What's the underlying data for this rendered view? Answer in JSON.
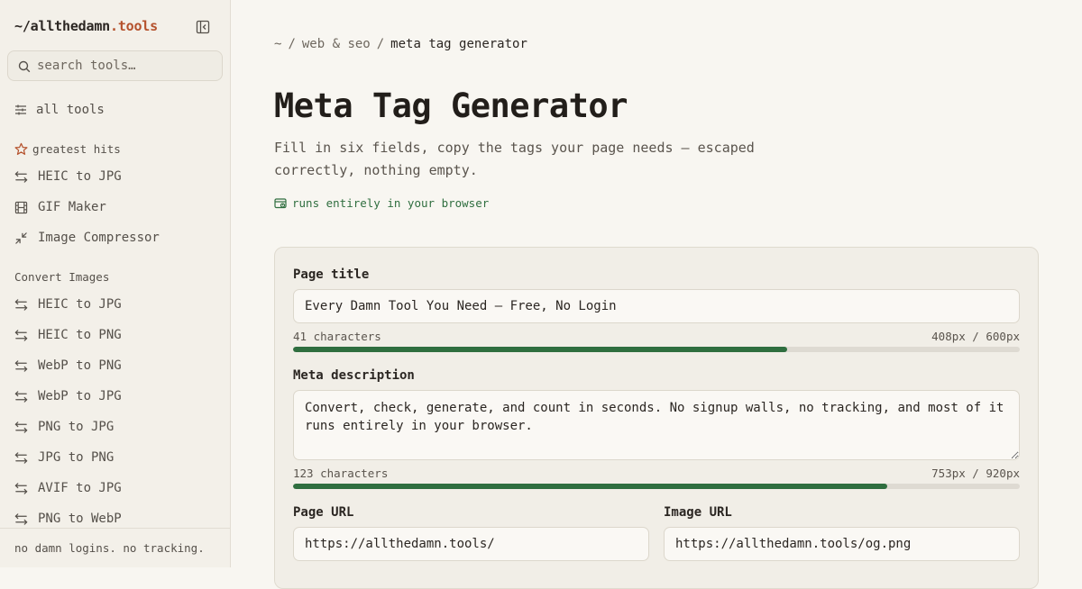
{
  "sidebar": {
    "brand": {
      "prefix": "~/",
      "name": "allthedamn",
      "suffix": ".tools"
    },
    "search": {
      "placeholder": "search tools…"
    },
    "all_tools": "all tools",
    "greatest_hits": {
      "title": "greatest hits",
      "items": [
        {
          "label": "HEIC to JPG",
          "icon": "convert-arrows-icon"
        },
        {
          "label": "GIF Maker",
          "icon": "film-icon"
        },
        {
          "label": "Image Compressor",
          "icon": "compress-icon"
        }
      ]
    },
    "convert_images": {
      "title": "Convert Images",
      "items": [
        {
          "label": "HEIC to JPG",
          "icon": "convert-arrows-icon"
        },
        {
          "label": "HEIC to PNG",
          "icon": "convert-arrows-icon"
        },
        {
          "label": "WebP to PNG",
          "icon": "convert-arrows-icon"
        },
        {
          "label": "WebP to JPG",
          "icon": "convert-arrows-icon"
        },
        {
          "label": "PNG to JPG",
          "icon": "convert-arrows-icon"
        },
        {
          "label": "JPG to PNG",
          "icon": "convert-arrows-icon"
        },
        {
          "label": "AVIF to JPG",
          "icon": "convert-arrows-icon"
        },
        {
          "label": "PNG to WebP",
          "icon": "convert-arrows-icon"
        }
      ]
    },
    "footer": "no damn logins. no tracking."
  },
  "breadcrumb": {
    "root": "~",
    "section": "web & seo",
    "current": "meta tag generator",
    "separator": "/"
  },
  "page": {
    "title": "Meta Tag Generator",
    "subtitle": "Fill in six fields, copy the tags your page needs — escaped correctly, nothing empty.",
    "badge": "runs entirely in your browser"
  },
  "form": {
    "page_title": {
      "label": "Page title",
      "value": "Every Damn Tool You Need — Free, No Login",
      "chars": "41 characters",
      "px": "408px / 600px",
      "fill": 0.68
    },
    "meta_description": {
      "label": "Meta description",
      "value": "Convert, check, generate, and count in seconds. No signup walls, no tracking, and most of it runs entirely in your browser.",
      "chars": "123 characters",
      "px": "753px / 920px",
      "fill": 0.818
    },
    "page_url": {
      "label": "Page URL",
      "value": "https://allthedamn.tools/"
    },
    "image_url": {
      "label": "Image URL",
      "value": "https://allthedamn.tools/og.png"
    }
  },
  "colors": {
    "accent": "#b5522d",
    "success": "#2f6e3f",
    "background": "#f8f6f1",
    "sidebar": "#f3f0e9"
  }
}
